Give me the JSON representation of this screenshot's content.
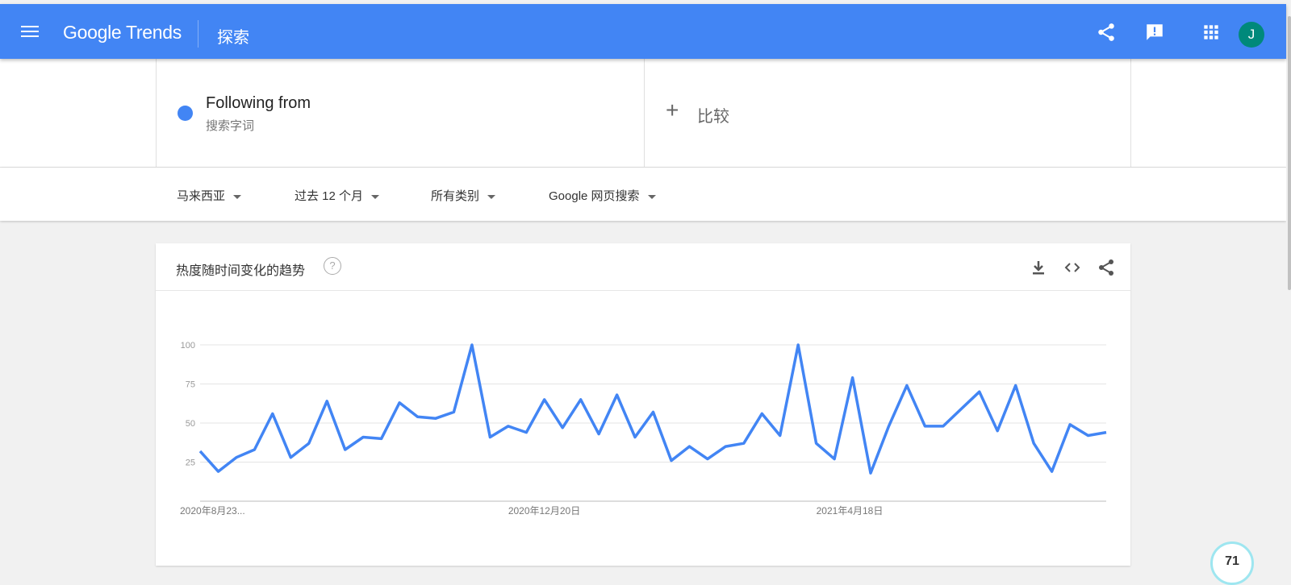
{
  "header": {
    "logo": "Google Trends",
    "page_title": "探索",
    "avatar_letter": "J",
    "icons": [
      "menu-icon",
      "share-icon",
      "feedback-icon",
      "apps-icon"
    ]
  },
  "search": {
    "term": "Following from",
    "term_type": "搜索字词",
    "term_color": "#4285f4",
    "compare_label": "比较"
  },
  "filters": [
    {
      "label": "马来西亚"
    },
    {
      "label": "过去 12 个月"
    },
    {
      "label": "所有类别"
    },
    {
      "label": "Google 网页搜索"
    }
  ],
  "chart_card": {
    "title": "热度随时间变化的趋势",
    "help": "?",
    "icons": [
      "download-icon",
      "embed-icon",
      "share-icon"
    ]
  },
  "chart_data": {
    "type": "line",
    "x_tick_labels": [
      "2020年8月23...",
      "2020年12月20日",
      "2021年4月18日"
    ],
    "x_tick_indices": [
      0,
      17,
      34
    ],
    "y_ticks": [
      25,
      50,
      75,
      100
    ],
    "ylim": [
      0,
      100
    ],
    "grid": true,
    "series": [
      {
        "color": "#4285f4",
        "values": [
          32,
          19,
          28,
          33,
          56,
          28,
          37,
          64,
          33,
          41,
          40,
          63,
          54,
          53,
          57,
          100,
          41,
          48,
          44,
          65,
          47,
          65,
          43,
          68,
          41,
          57,
          26,
          35,
          27,
          35,
          37,
          56,
          42,
          100,
          37,
          27,
          79,
          18,
          48,
          74,
          48,
          48,
          59,
          70,
          45,
          74,
          37,
          19,
          49,
          42,
          44
        ]
      }
    ]
  },
  "floating_badge": "71"
}
